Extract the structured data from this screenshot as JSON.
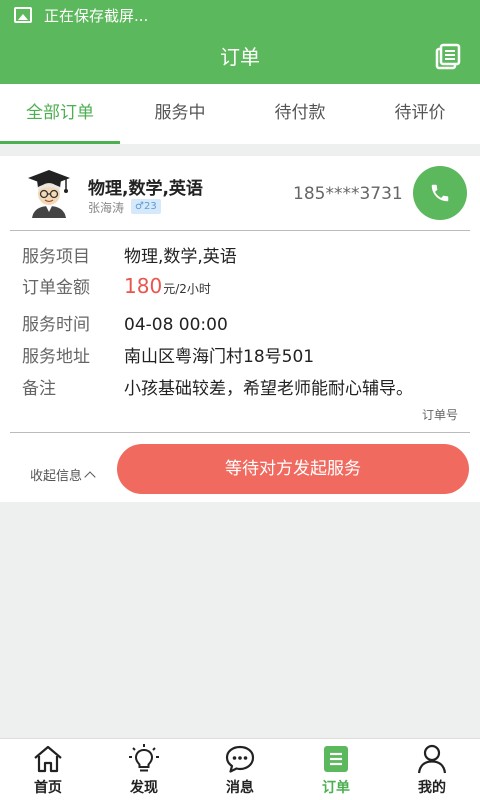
{
  "status_bar": {
    "text": "正在保存截屏..."
  },
  "app_bar": {
    "title": "订单"
  },
  "tabs": [
    {
      "label": "全部订单",
      "active": true
    },
    {
      "label": "服务中",
      "active": false
    },
    {
      "label": "待付款",
      "active": false
    },
    {
      "label": "待评价",
      "active": false
    }
  ],
  "order": {
    "subject": "物理,数学,英语",
    "teacher_name": "张海涛",
    "gender_age": "♂23",
    "phone": "185****3731",
    "rows": {
      "service_item": {
        "label": "服务项目",
        "value": "物理,数学,英语"
      },
      "amount": {
        "label": "订单金额",
        "price": "180",
        "unit": "元/2小时"
      },
      "time": {
        "label": "服务时间",
        "value": "04-08 00:00"
      },
      "address": {
        "label": "服务地址",
        "value": "南山区粤海门村18号501"
      },
      "note": {
        "label": "备注",
        "value": "小孩基础较差，希望老师能耐心辅导。"
      }
    },
    "order_no_label": "订单号",
    "collapse_label": "收起信息",
    "action_label": "等待对方发起服务"
  },
  "bottom_nav": [
    {
      "label": "首页",
      "icon": "home-icon",
      "active": false
    },
    {
      "label": "发现",
      "icon": "bulb-icon",
      "active": false
    },
    {
      "label": "消息",
      "icon": "chat-icon",
      "active": false
    },
    {
      "label": "订单",
      "icon": "order-icon",
      "active": true
    },
    {
      "label": "我的",
      "icon": "user-icon",
      "active": false
    }
  ],
  "colors": {
    "primary": "#5cb85c",
    "accent_red": "#f06a5f",
    "price_red": "#e8554e"
  }
}
